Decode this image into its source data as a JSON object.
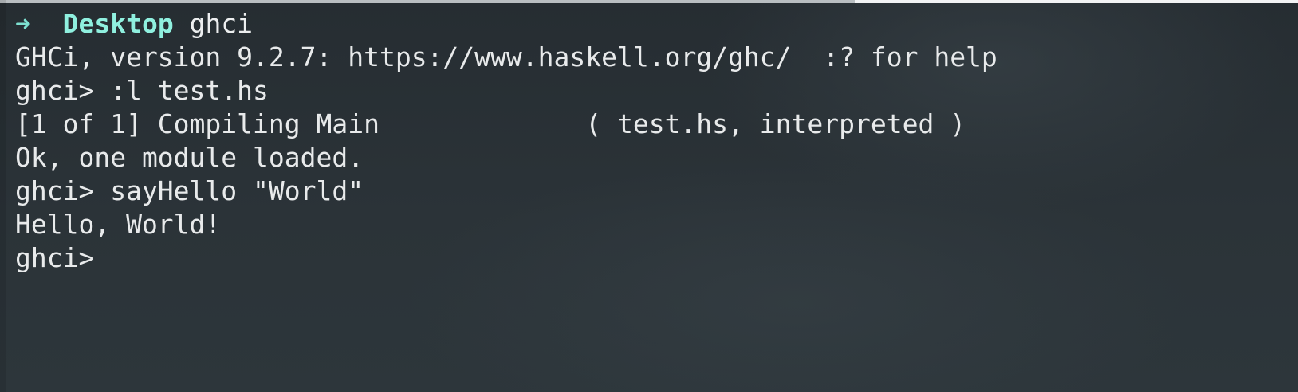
{
  "prompt": {
    "arrow": "➜",
    "directory": "Desktop",
    "command": "ghci"
  },
  "lines": [
    "GHCi, version 9.2.7: https://www.haskell.org/ghc/  :? for help",
    "ghci> :l test.hs",
    "[1 of 1] Compiling Main             ( test.hs, interpreted )",
    "Ok, one module loaded.",
    "ghci> sayHello \"World\"",
    "Hello, World!",
    "ghci> "
  ],
  "colors": {
    "background": "#2a3237",
    "text": "#e8eaeb",
    "prompt_accent": "#8ff0df"
  }
}
